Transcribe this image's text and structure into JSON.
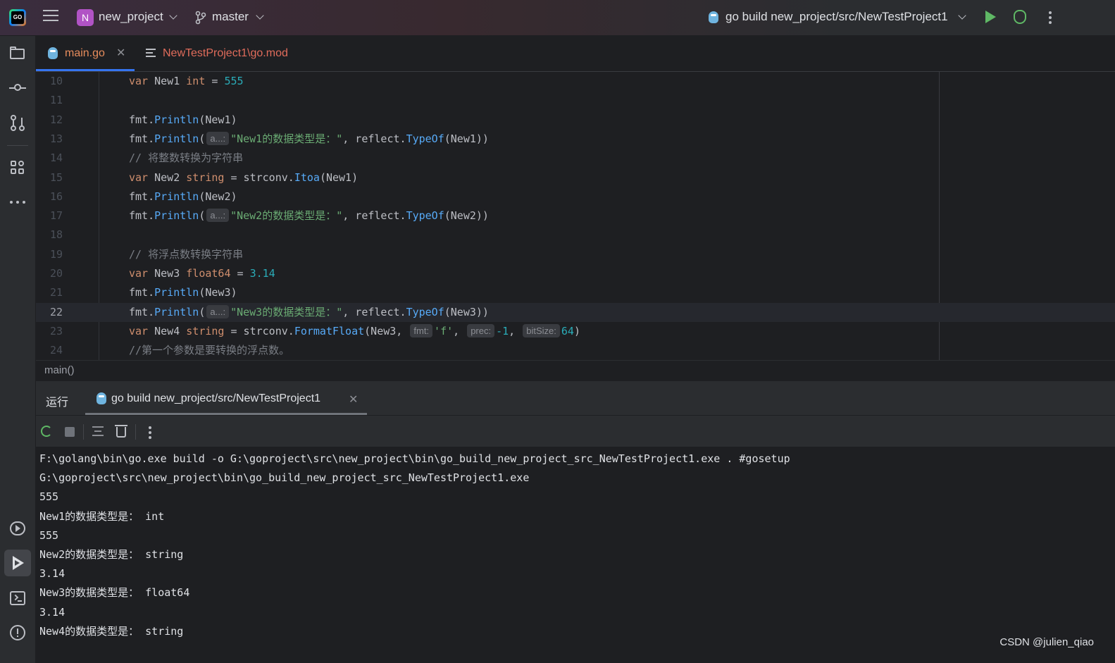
{
  "titlebar": {
    "logo_text": "GO",
    "project_initial": "N",
    "project_name": "new_project",
    "branch": "master",
    "run_config": "go build new_project/src/NewTestProject1"
  },
  "editor_tabs": [
    {
      "label": "main.go",
      "active": true
    },
    {
      "label": "NewTestProject1\\go.mod",
      "active": false
    }
  ],
  "code_lines": [
    {
      "ln": "10",
      "parts": [
        [
          "kw",
          "var"
        ],
        [
          "id",
          " New1 "
        ],
        [
          "kw",
          "int"
        ],
        [
          "id",
          " = "
        ],
        [
          "num",
          "555"
        ]
      ]
    },
    {
      "ln": "11",
      "parts": []
    },
    {
      "ln": "12",
      "parts": [
        [
          "pkg",
          "fmt."
        ],
        [
          "call",
          "Println"
        ],
        [
          "id",
          "(New1)"
        ]
      ]
    },
    {
      "ln": "13",
      "parts": [
        [
          "pkg",
          "fmt."
        ],
        [
          "call",
          "Println"
        ],
        [
          "id",
          "("
        ],
        [
          "hint",
          "a...:"
        ],
        [
          "str",
          "\"New1的数据类型是：\""
        ],
        [
          "id",
          ", reflect."
        ],
        [
          "call",
          "TypeOf"
        ],
        [
          "id",
          "(New1))"
        ]
      ]
    },
    {
      "ln": "14",
      "parts": [
        [
          "cmt",
          "// 将整数转换为字符串"
        ]
      ]
    },
    {
      "ln": "15",
      "parts": [
        [
          "kw",
          "var"
        ],
        [
          "id",
          " New2 "
        ],
        [
          "kw",
          "string"
        ],
        [
          "id",
          " = strconv."
        ],
        [
          "call",
          "Itoa"
        ],
        [
          "id",
          "(New1)"
        ]
      ]
    },
    {
      "ln": "16",
      "parts": [
        [
          "pkg",
          "fmt."
        ],
        [
          "call",
          "Println"
        ],
        [
          "id",
          "(New2)"
        ]
      ]
    },
    {
      "ln": "17",
      "parts": [
        [
          "pkg",
          "fmt."
        ],
        [
          "call",
          "Println"
        ],
        [
          "id",
          "("
        ],
        [
          "hint",
          "a...:"
        ],
        [
          "str",
          "\"New2的数据类型是：\""
        ],
        [
          "id",
          ", reflect."
        ],
        [
          "call",
          "TypeOf"
        ],
        [
          "id",
          "(New2))"
        ]
      ]
    },
    {
      "ln": "18",
      "parts": []
    },
    {
      "ln": "19",
      "parts": [
        [
          "cmt",
          "// 将浮点数转换字符串"
        ]
      ]
    },
    {
      "ln": "20",
      "parts": [
        [
          "kw",
          "var"
        ],
        [
          "id",
          " New3 "
        ],
        [
          "kw",
          "float64"
        ],
        [
          "id",
          " = "
        ],
        [
          "num",
          "3.14"
        ]
      ]
    },
    {
      "ln": "21",
      "parts": [
        [
          "pkg",
          "fmt."
        ],
        [
          "call",
          "Println"
        ],
        [
          "id",
          "(New3)"
        ]
      ]
    },
    {
      "ln": "22",
      "current": true,
      "parts": [
        [
          "pkg",
          "fmt."
        ],
        [
          "call",
          "Println"
        ],
        [
          "id",
          "("
        ],
        [
          "hint",
          "a...:"
        ],
        [
          "str",
          "\"New3的数据类型是：\""
        ],
        [
          "id",
          ", reflect."
        ],
        [
          "call",
          "TypeOf"
        ],
        [
          "id",
          "(New3))"
        ]
      ]
    },
    {
      "ln": "23",
      "parts": [
        [
          "kw",
          "var"
        ],
        [
          "id",
          " New4 "
        ],
        [
          "kw",
          "string"
        ],
        [
          "id",
          " = strconv."
        ],
        [
          "call",
          "FormatFloat"
        ],
        [
          "id",
          "(New3, "
        ],
        [
          "hint",
          "fmt:"
        ],
        [
          "str",
          "'f'"
        ],
        [
          "id",
          ", "
        ],
        [
          "hint",
          "prec:"
        ],
        [
          "num",
          "-1"
        ],
        [
          "id",
          ", "
        ],
        [
          "hint",
          "bitSize:"
        ],
        [
          "num",
          "64"
        ],
        [
          "id",
          ")"
        ]
      ]
    },
    {
      "ln": "24",
      "parts": [
        [
          "cmt",
          "//第一个参数是要转换的浮点数。"
        ]
      ]
    }
  ],
  "breadcrumb": "main()",
  "run_panel": {
    "title": "运行",
    "tab_label": "go build new_project/src/NewTestProject1"
  },
  "console_lines": [
    "F:\\golang\\bin\\go.exe build -o G:\\goproject\\src\\new_project\\bin\\go_build_new_project_src_NewTestProject1.exe . #gosetup",
    "G:\\goproject\\src\\new_project\\bin\\go_build_new_project_src_NewTestProject1.exe",
    "555",
    "New1的数据类型是： int",
    "555",
    "New2的数据类型是： string",
    "3.14",
    "New3的数据类型是： float64",
    "3.14",
    "New4的数据类型是： string"
  ],
  "watermark": "CSDN @julien_qiao",
  "colors": {
    "keyword": "#cf8e6d",
    "number": "#2aacb8",
    "string": "#6aab73",
    "function": "#57aaf7",
    "comment": "#7a7e85",
    "run_green": "#5fb865",
    "accent": "#3574f0"
  },
  "icons": [
    "goland-logo-icon",
    "hamburger-menu-icon",
    "branch-icon",
    "gopher-icon",
    "run-icon",
    "debug-icon",
    "more-icon",
    "folder-icon",
    "commit-icon",
    "pull-request-icon",
    "plugins-icon",
    "more-tools-icon",
    "services-icon",
    "run-tool-icon",
    "terminal-icon",
    "problems-icon",
    "file-lines-icon",
    "close-icon",
    "rerun-icon",
    "stop-icon",
    "scroll-to-end-icon",
    "trash-icon",
    "chevron-down-icon"
  ]
}
